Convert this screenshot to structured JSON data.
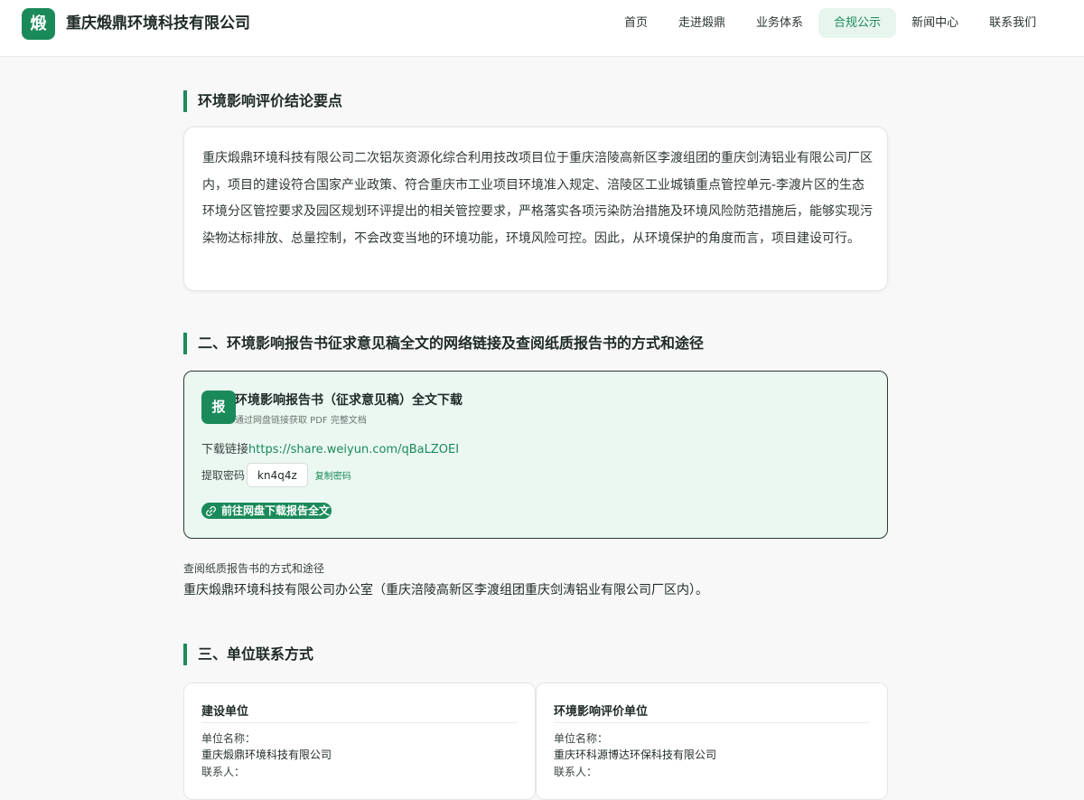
{
  "header": {
    "logo_char": "煅",
    "company_name": "重庆煅鼎环境科技有限公司",
    "nav": [
      {
        "label": "首页",
        "active": false
      },
      {
        "label": "走进煅鼎",
        "active": false
      },
      {
        "label": "业务体系",
        "active": false
      },
      {
        "label": "合规公示",
        "active": true
      },
      {
        "label": "新闻中心",
        "active": false
      },
      {
        "label": "联系我们",
        "active": false
      }
    ]
  },
  "conclusion": {
    "title": "环境影响评价结论要点",
    "text": "重庆煅鼎环境科技有限公司二次铝灰资源化综合利用技改项目位于重庆涪陵高新区李渡组团的重庆剑涛铝业有限公司厂区内，项目的建设符合国家产业政策、符合重庆市工业项目环境准入规定、涪陵区工业城镇重点管控单元-李渡片区的生态环境分区管控要求及园区规划环评提出的相关管控要求，严格落实各项污染防治措施及环境风险防范措施后，能够实现污染物达标排放、总量控制，不会改变当地的环境功能，环境风险可控。因此，从环境保护的角度而言，项目建设可行。"
  },
  "section2": {
    "title": "二、环境影响报告书征求意见稿全文的网络链接及查阅纸质报告书的方式和途径",
    "download": {
      "icon_char": "报",
      "title": "环境影响报告书（征求意见稿）全文下载",
      "subtitle": "通过网盘链接获取 PDF 完整文档",
      "link_label": "下载链接",
      "link_url": "https://share.weiyun.com/qBaLZOEI",
      "code_label": "提取密码",
      "code": "kn4q4z",
      "copy_label": "复制密码",
      "button_label": "前往网盘下载报告全文"
    },
    "paper_label": "查阅纸质报告书的方式和途径",
    "paper_text": "重庆煅鼎环境科技有限公司办公室（重庆涪陵高新区李渡组团重庆剑涛铝业有限公司厂区内）。"
  },
  "section3": {
    "title": "三、单位联系方式",
    "builder": {
      "title": "建设单位",
      "name_label": "单位名称：",
      "name": "重庆煅鼎环境科技有限公司",
      "contact_label": "联系人："
    },
    "assessor": {
      "title": "环境影响评价单位",
      "name_label": "单位名称：",
      "name": "重庆环科源博达环保科技有限公司",
      "contact_label": "联系人："
    }
  },
  "colors": {
    "accent": "#1b8a5a",
    "accent_light": "#ebf8f2"
  }
}
